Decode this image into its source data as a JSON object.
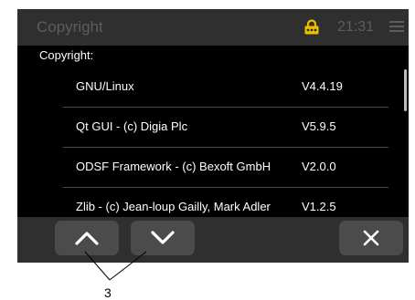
{
  "header": {
    "title": "Copyright",
    "lock_icon": "lock-icon",
    "lock_color": "#f0c000",
    "time": "21:31",
    "menu_icon": "hamburger-menu-icon"
  },
  "content": {
    "section_label": "Copyright:",
    "items": [
      {
        "name": "GNU/Linux",
        "version": "V4.4.19"
      },
      {
        "name": "Qt GUI - (c) Digia Plc",
        "version": "V5.9.5"
      },
      {
        "name": "ODSF Framework - (c) Bexoft GmbH",
        "version": "V2.0.0"
      },
      {
        "name": "Zlib - (c) Jean-loup Gailly, Mark Adler",
        "version": "V1.2.5"
      }
    ]
  },
  "footer": {
    "buttons": [
      {
        "icon": "chevron-up-icon"
      },
      {
        "icon": "chevron-down-icon"
      },
      {
        "icon": "close-icon"
      }
    ]
  },
  "callout": {
    "number": "3"
  }
}
